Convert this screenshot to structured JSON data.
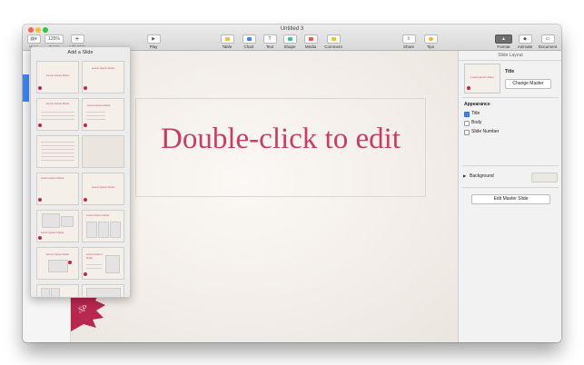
{
  "window": {
    "title": "Untitled 3",
    "traffic_lights": {
      "close": "#fc5f57",
      "minimize": "#fdbc2e",
      "zoom": "#28c840"
    }
  },
  "toolbar": {
    "view": {
      "label": "View",
      "icon": "sidebar-icon"
    },
    "zoom": {
      "label": "Zoom",
      "value": "125%"
    },
    "add_slide": {
      "label": "Add Slide",
      "icon": "plus-icon"
    },
    "play": {
      "label": "Play",
      "icon": "play-icon"
    },
    "table": {
      "label": "Table",
      "icon": "table-icon",
      "color": "#f2c230"
    },
    "chart": {
      "label": "Chart",
      "icon": "chart-icon",
      "color": "#3d86f5"
    },
    "text": {
      "label": "Text",
      "icon": "text-icon",
      "glyph": "T"
    },
    "shape": {
      "label": "Shape",
      "icon": "shape-icon",
      "color": "#3fbf9f"
    },
    "media": {
      "label": "Media",
      "icon": "media-icon",
      "color": "#e9584a"
    },
    "comment": {
      "label": "Comment",
      "icon": "comment-icon",
      "color": "#f6c12f"
    },
    "share": {
      "label": "Share",
      "icon": "share-icon"
    },
    "tips": {
      "label": "Tips",
      "icon": "lightbulb-icon",
      "color": "#f6b12f"
    },
    "format": {
      "label": "Format",
      "icon": "paintbrush-icon",
      "active": true
    },
    "animate": {
      "label": "Animate",
      "icon": "animate-icon"
    },
    "document": {
      "label": "Document",
      "icon": "document-icon"
    }
  },
  "canvas": {
    "placeholder_text": "Double-click to edit",
    "accent": "#c43f62",
    "seal_text": "SP"
  },
  "add_slide_popover": {
    "title": "Add a Slide",
    "thumb_text": "Lorem Ipsum Dolor"
  },
  "inspector": {
    "header": "Slide Layout",
    "master_title": "Title",
    "change_master_button": "Change Master",
    "appearance_label": "Appearance",
    "checkboxes": [
      {
        "label": "Title",
        "checked": true
      },
      {
        "label": "Body",
        "checked": false
      },
      {
        "label": "Slide Number",
        "checked": false
      }
    ],
    "background_label": "Background",
    "edit_master_button": "Edit Master Slide"
  }
}
